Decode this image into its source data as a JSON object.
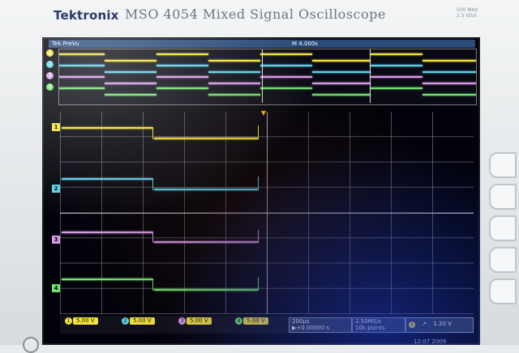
{
  "brand": "Tektronix",
  "model": "MSO 4054  Mixed Signal Oscilloscope",
  "spec_lines": [
    "500 MHz",
    "2.5 GS/s"
  ],
  "top_bar": {
    "left": "Tek PreVu",
    "center": "M 4.000s"
  },
  "channels": [
    {
      "id": "1",
      "color": "#f2e23a",
      "scale": "5.00 V"
    },
    {
      "id": "2",
      "color": "#5ed0e6",
      "scale": "5.00 V"
    },
    {
      "id": "3",
      "color": "#d79be8",
      "scale": "5.00 V"
    },
    {
      "id": "4",
      "color": "#6fe36c",
      "scale": "5.00 V"
    }
  ],
  "horizontal": {
    "timebase": "200μs",
    "position": "▶+0.00000 s"
  },
  "acquisition": {
    "rate": "2.50MS/s",
    "points": "10k points"
  },
  "trigger": {
    "source": "1",
    "slope": "↗",
    "level": "1.20 V"
  },
  "clock_text": "12:07 2009",
  "colors": {
    "accent": "#ffb000",
    "status_box": "#f2e23a"
  }
}
